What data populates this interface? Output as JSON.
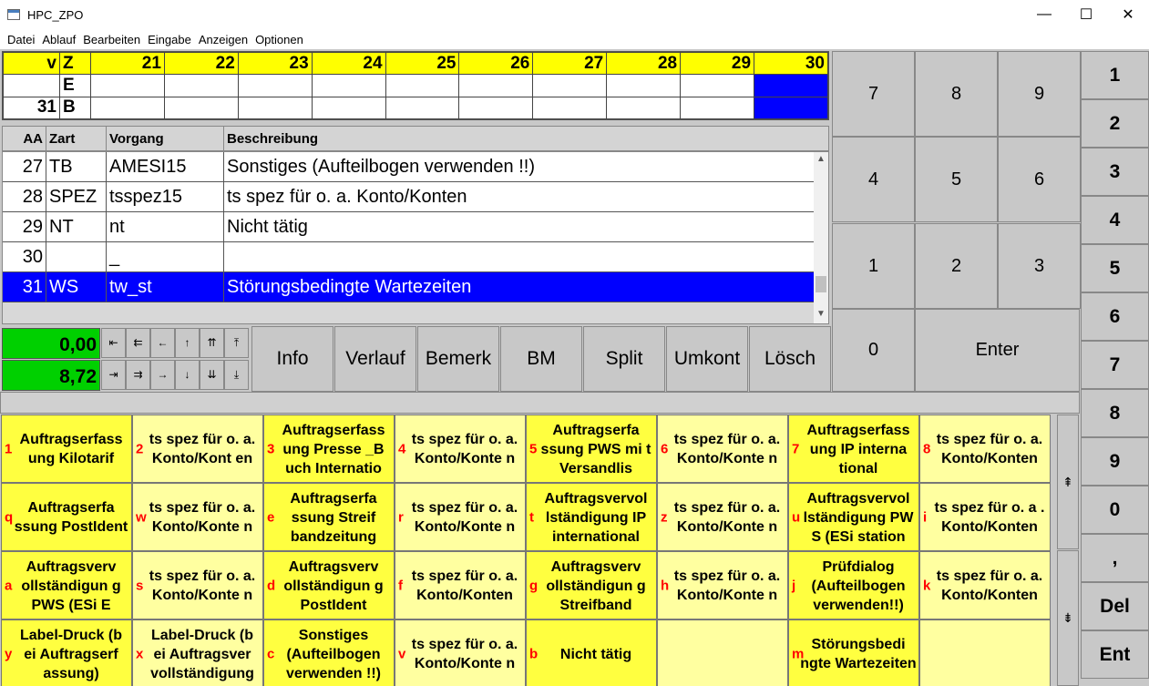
{
  "window": {
    "title": "HPC_ZPO",
    "minimize": "—",
    "maximize": "☐",
    "close": "✕"
  },
  "menu": [
    "Datei",
    "Ablauf",
    "Bearbeiten",
    "Eingabe",
    "Anzeigen",
    "Optionen"
  ],
  "topgrid": {
    "header": [
      "v",
      "Z",
      "21",
      "22",
      "23",
      "24",
      "25",
      "26",
      "27",
      "28",
      "29",
      "30"
    ],
    "row2": [
      "",
      "E",
      "",
      "",
      "",
      "",
      "",
      "",
      "",
      "",
      "",
      ""
    ],
    "row3": [
      "31",
      "B",
      "",
      "",
      "",
      "",
      "",
      "",
      "",
      "",
      "",
      ""
    ]
  },
  "activity": {
    "headers": [
      "AA",
      "Zart",
      "Vorgang",
      "Beschreibung"
    ],
    "rows": [
      [
        "27",
        "TB",
        "AMESI15",
        "Sonstiges (Aufteilbogen verwenden !!)"
      ],
      [
        "28",
        "SPEZ",
        "tsspez15",
        "ts spez für o. a. Konto/Konten"
      ],
      [
        "29",
        "NT",
        "nt",
        "Nicht tätig"
      ],
      [
        "30",
        "",
        "_",
        ""
      ],
      [
        "31",
        "WS",
        "tw_st",
        "Störungsbedingte Wartezeiten"
      ]
    ]
  },
  "counters": {
    "top": "0,00",
    "bottom": "8,72"
  },
  "nav": {
    "top": [
      "⇤",
      "⇇",
      "←",
      "↑",
      "⇈",
      "⤒"
    ],
    "bottom": [
      "⇥",
      "⇉",
      "→",
      "↓",
      "⇊",
      "⤓"
    ]
  },
  "funcs": [
    "Info",
    "Verlauf",
    "Bemerk",
    "BM",
    "Split",
    "Umkont",
    "Lösch"
  ],
  "keypad": [
    "7",
    "8",
    "9",
    "4",
    "5",
    "6",
    "1",
    "2",
    "3",
    "0",
    "Enter"
  ],
  "rightkeys": [
    "1",
    "2",
    "3",
    "4",
    "5",
    "6",
    "7",
    "8",
    "9",
    "0",
    ",",
    "Del",
    "Ent"
  ],
  "activities": [
    {
      "k": "1",
      "t": "Auftragserfass ung Kilotarif"
    },
    {
      "k": "2",
      "t": "ts spez für o. a. Konto/Kont en"
    },
    {
      "k": "3",
      "t": "Auftragserfass ung Presse _B uch Internatio"
    },
    {
      "k": "4",
      "t": "ts spez für o. a. Konto/Konte n"
    },
    {
      "k": "5",
      "t": "Auftragserfa ssung PWS mi t Versandlis"
    },
    {
      "k": "6",
      "t": "ts spez für o. a. Konto/Konte n"
    },
    {
      "k": "7",
      "t": "Auftragserfass ung IP interna tional"
    },
    {
      "k": "8",
      "t": "ts spez für o. a. Konto/Konten"
    },
    {
      "k": "q",
      "t": "Auftragserfa ssung PostIdent"
    },
    {
      "k": "w",
      "t": "ts spez für o. a. Konto/Konte n"
    },
    {
      "k": "e",
      "t": "Auftragserfa ssung Streif bandzeitung"
    },
    {
      "k": "r",
      "t": "ts spez für o. a. Konto/Konte n"
    },
    {
      "k": "t",
      "t": "Auftragsvervol lständigung IP international"
    },
    {
      "k": "z",
      "t": "ts spez für o. a. Konto/Konte n"
    },
    {
      "k": "u",
      "t": "Auftragsvervol lständigung PW S (ESi station"
    },
    {
      "k": "i",
      "t": "ts spez für o. a . Konto/Konten"
    },
    {
      "k": "a",
      "t": "Auftragsverv ollständigun g PWS (ESi E"
    },
    {
      "k": "s",
      "t": "ts spez für o. a. Konto/Konte n"
    },
    {
      "k": "d",
      "t": "Auftragsverv ollständigun g PostIdent"
    },
    {
      "k": "f",
      "t": "ts spez für o. a. Konto/Konten"
    },
    {
      "k": "g",
      "t": "Auftragsverv ollständigun g Streifband"
    },
    {
      "k": "h",
      "t": "ts spez für o. a. Konto/Konte n"
    },
    {
      "k": "j",
      "t": "Prüfdialog (Aufteilbogen verwenden!!)"
    },
    {
      "k": "k",
      "t": "ts spez für o. a. Konto/Konten"
    },
    {
      "k": "y",
      "t": "Label-Druck (b ei Auftragserf assung)"
    },
    {
      "k": "x",
      "t": "Label-Druck (b ei Auftragsver vollständigung"
    },
    {
      "k": "c",
      "t": "Sonstiges (Aufteilbogen verwenden !!)"
    },
    {
      "k": "v",
      "t": "ts spez für o. a. Konto/Konte n"
    },
    {
      "k": "b",
      "t": "Nicht tätig"
    },
    {
      "k": "",
      "t": ""
    },
    {
      "k": "m",
      "t": "Störungsbedi ngte Wartezeiten"
    },
    {
      "k": "",
      "t": ""
    }
  ],
  "side": {
    "up": "⇞",
    "down": "⇟"
  }
}
